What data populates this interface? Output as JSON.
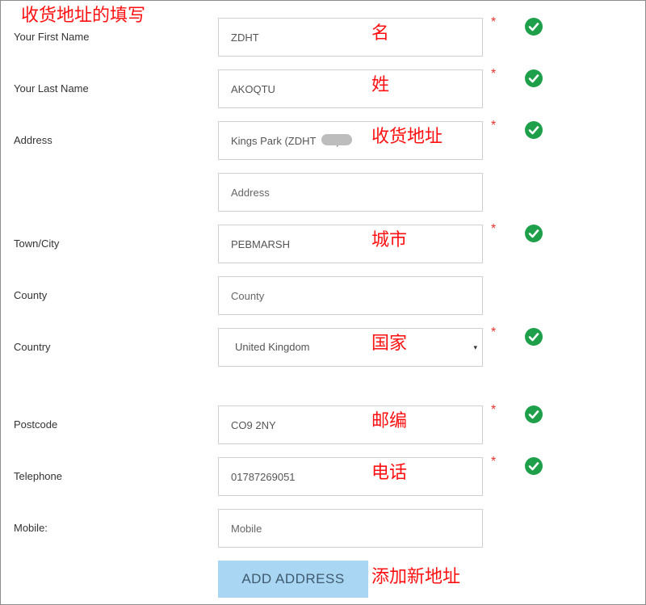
{
  "header": {
    "annotation": "收货地址的填写"
  },
  "form": {
    "first_name": {
      "label": "Your First Name",
      "value": "ZDHT",
      "annotation": "名"
    },
    "last_name": {
      "label": "Your Last Name",
      "value": "AKOQTU",
      "annotation": "姓"
    },
    "address1": {
      "label": "Address",
      "value": "Kings Park (ZDHT       )",
      "annotation": "收货地址"
    },
    "address2": {
      "placeholder": "Address"
    },
    "town": {
      "label": "Town/City",
      "value": "PEBMARSH",
      "annotation": "城市"
    },
    "county": {
      "label": "County",
      "placeholder": "County"
    },
    "country": {
      "label": "Country",
      "value": "United Kingdom",
      "annotation": "国家",
      "caret": "▾"
    },
    "postcode": {
      "label": "Postcode",
      "value": "CO9 2NY",
      "annotation": "邮编"
    },
    "telephone": {
      "label": "Telephone",
      "value": "01787269051",
      "annotation": "电话"
    },
    "mobile": {
      "label": "Mobile:",
      "placeholder": "Mobile"
    },
    "required_mark": "*"
  },
  "actions": {
    "add_address_label": "ADD ADDRESS",
    "add_address_annotation": "添加新地址"
  },
  "colors": {
    "valid": "#1ea04b",
    "required": "#e0312b",
    "annotation": "#ff1010",
    "button": "#a9d6f2"
  },
  "icons": {
    "valid": "check-circle-icon"
  }
}
